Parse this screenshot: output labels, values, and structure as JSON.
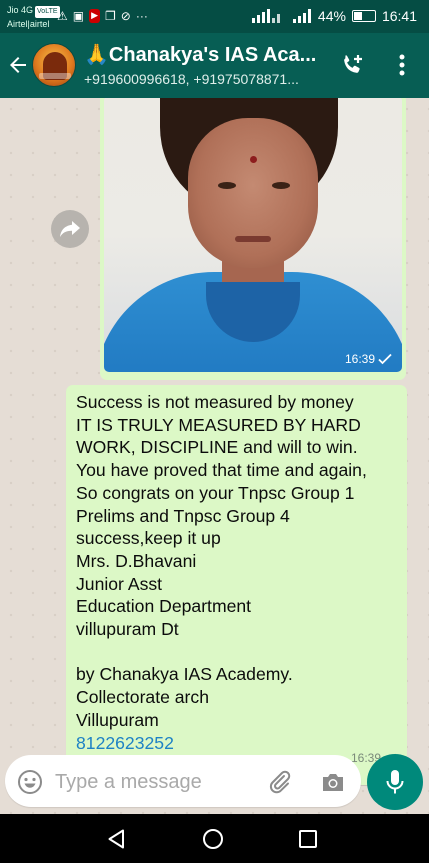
{
  "status_bar": {
    "carrier_line1": "Jio 4G",
    "volte": "VoLTE",
    "carrier_line2": "Airtel|airtel",
    "battery_text": "44%",
    "battery_level": 0.44,
    "time": "16:41",
    "notification_icons": [
      "warning-icon",
      "gallery-icon",
      "youtube-icon",
      "photos-icon",
      "blocked-icon",
      "more-icon"
    ]
  },
  "header": {
    "title": "🙏Chanakya's IAS Aca...",
    "subtitle": "+919600996618, +91975078871..."
  },
  "messages": {
    "image": {
      "time": "16:39"
    },
    "text": {
      "body": "Success is not measured by money\nIT IS TRULY MEASURED BY HARD WORK, DISCIPLINE and will to win.\nYou have proved that time and again,\nSo congrats on your Tnpsc Group 1 Prelims and Tnpsc  Group 4 success,keep it up\nMrs. D.Bhavani\nJunior Asst\nEducation Department\nvillupuram Dt\n\nby Chanakya IAS Academy.\nCollectorate arch\nVillupuram",
      "phone_link": "8122623252",
      "time": "16:39"
    }
  },
  "composer": {
    "placeholder": "Type a message"
  },
  "colors": {
    "header": "#075e54",
    "status_bar": "#054d44",
    "bubble_outgoing": "#dcf8c6",
    "mic_button": "#00897b",
    "link": "#1e82c5"
  }
}
